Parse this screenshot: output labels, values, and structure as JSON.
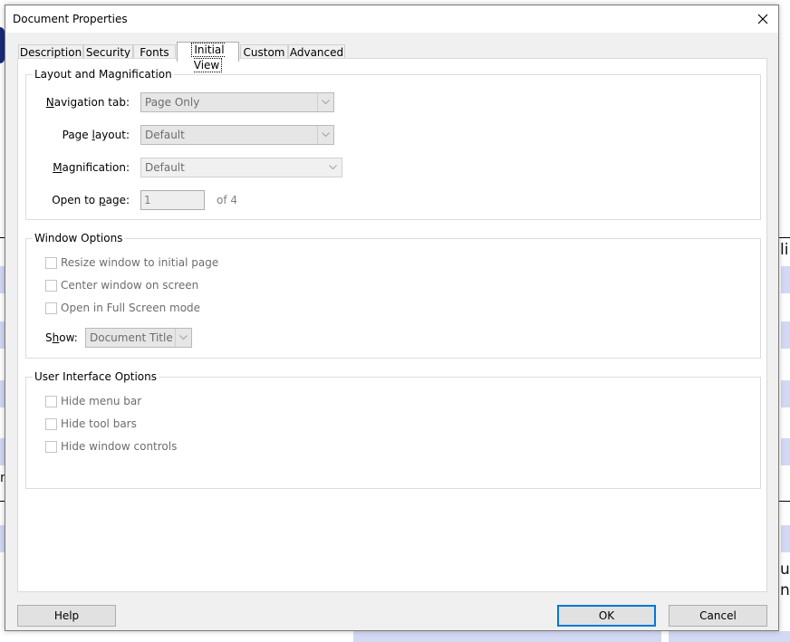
{
  "window": {
    "title": "Document Properties",
    "close_icon": "close-icon"
  },
  "tabs": [
    {
      "label": "Description",
      "active": false
    },
    {
      "label": "Security",
      "active": false
    },
    {
      "label": "Fonts",
      "active": false
    },
    {
      "label": "Initial View",
      "active": true
    },
    {
      "label": "Custom",
      "active": false
    },
    {
      "label": "Advanced",
      "active": false
    }
  ],
  "layout_group": {
    "title": "Layout and Magnification",
    "navigation_tab": {
      "label_pre": "",
      "label_key": "N",
      "label_post": "avigation tab:",
      "value": "Page Only"
    },
    "page_layout": {
      "label_pre": "Page ",
      "label_key": "l",
      "label_post": "ayout:",
      "value": "Default"
    },
    "magnification": {
      "label_pre": "",
      "label_key": "M",
      "label_post": "agnification:",
      "value": "Default"
    },
    "open_to_page": {
      "label_pre": "Open to ",
      "label_key": "p",
      "label_post": "age:",
      "value": "1",
      "of_text": "of 4"
    }
  },
  "window_group": {
    "title": "Window Options",
    "options": [
      {
        "label": "Resize window to initial page",
        "checked": false
      },
      {
        "label": "Center window on screen",
        "checked": false
      },
      {
        "label": "Open in Full Screen mode",
        "checked": false
      }
    ],
    "show": {
      "label_pre": "S",
      "label_key": "h",
      "label_post": "ow:",
      "value": "Document Title"
    }
  },
  "ui_group": {
    "title": "User Interface Options",
    "options": [
      {
        "label": "Hide menu bar",
        "checked": false
      },
      {
        "label": "Hide tool bars",
        "checked": false
      },
      {
        "label": "Hide window controls",
        "checked": false
      }
    ]
  },
  "buttons": {
    "help": "Help",
    "ok": "OK",
    "cancel": "Cancel"
  },
  "background": {
    "text_right_1": "lin",
    "text_left_1": "n",
    "text_right_2": "uk",
    "text_right_3": "na"
  },
  "colors": {
    "accent": "#0078d7",
    "disabled_text": "#6d6d6d"
  }
}
